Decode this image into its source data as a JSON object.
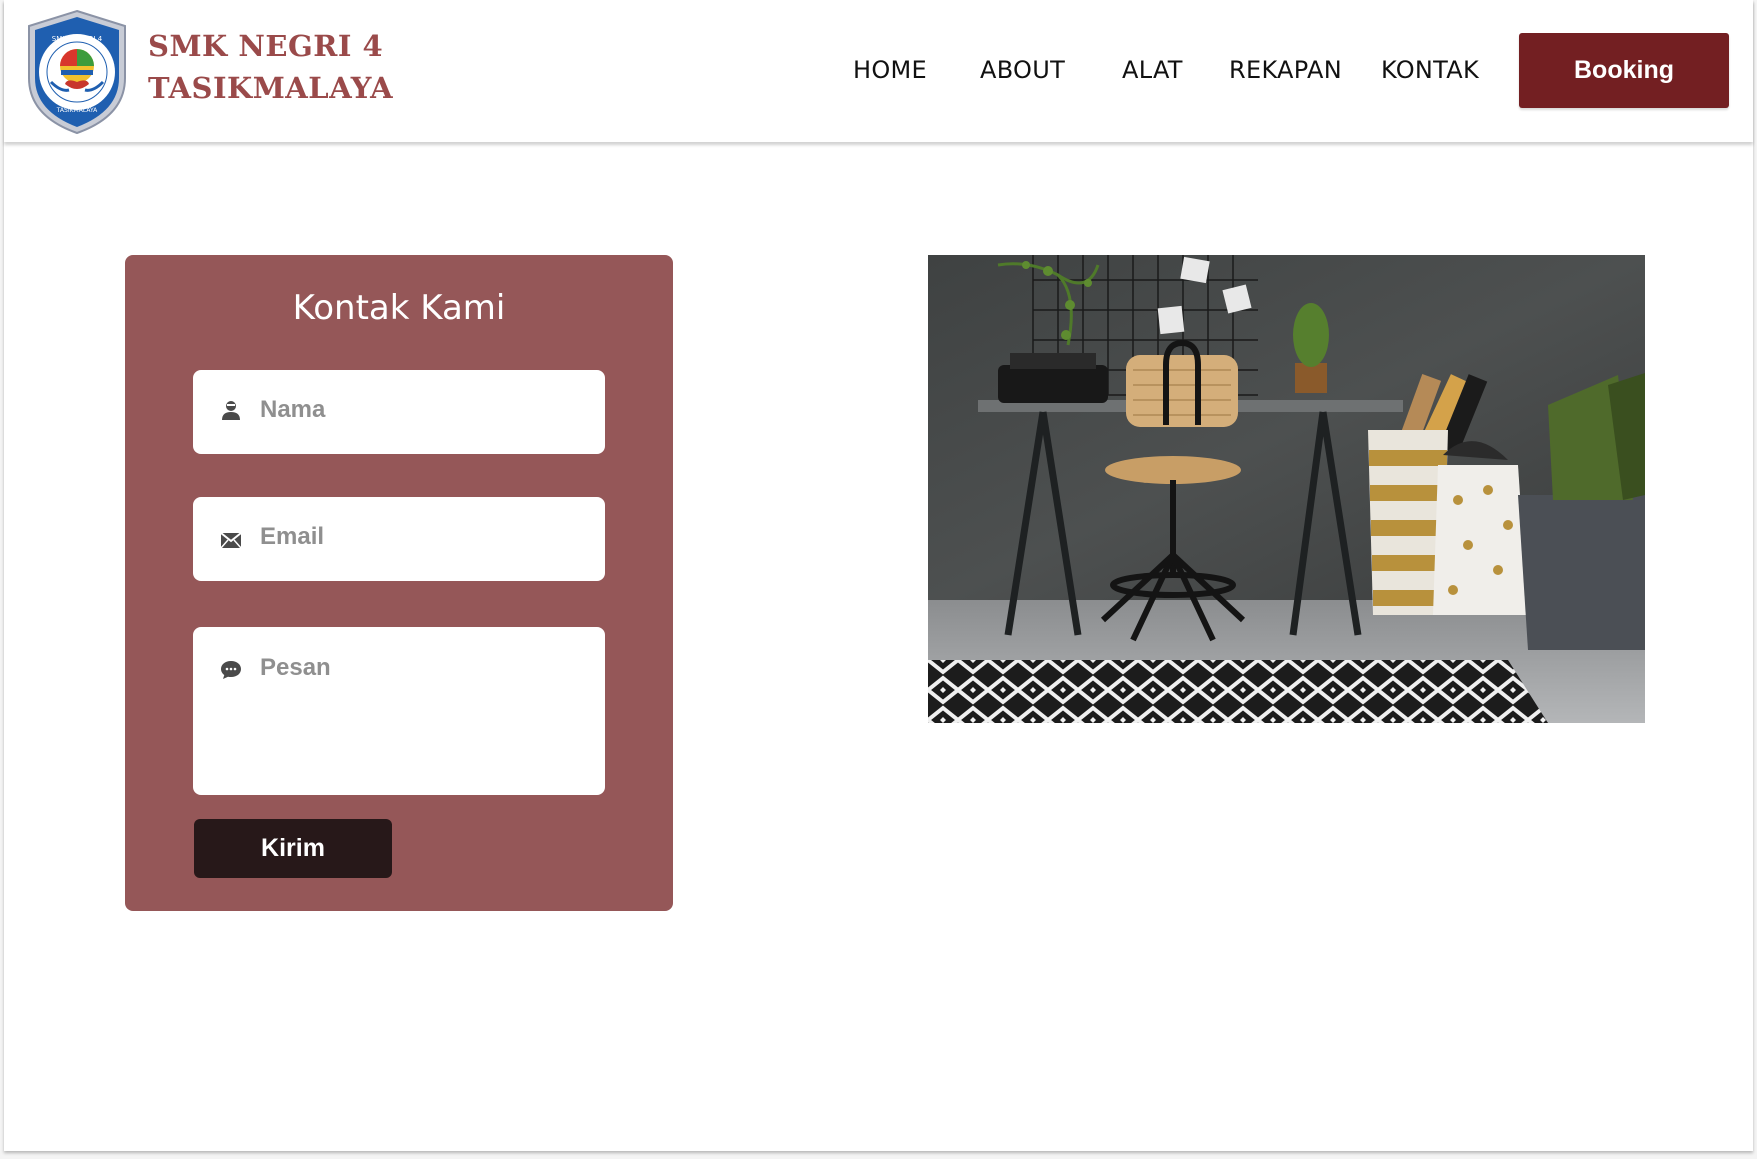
{
  "header": {
    "brand_line1": "SMK NEGRI 4",
    "brand_line2": "TASIKMALAYA",
    "logo_text_top": "SMK NEGERI 4",
    "logo_text_bottom": "TASIKMALAYA",
    "nav": {
      "home": "HOME",
      "about": "ABOUT",
      "alat": "ALAT",
      "rekapan": "REKAPAN",
      "kontak": "KONTAK"
    },
    "booking_label": "Booking"
  },
  "contact_form": {
    "title": "Kontak Kami",
    "name_placeholder": "Nama",
    "email_placeholder": "Email",
    "message_placeholder": "Pesan",
    "submit_label": "Kirim"
  },
  "colors": {
    "brand_text": "#9a4a4a",
    "booking_bg": "#731f22",
    "card_bg": "#955758",
    "submit_bg": "#271819"
  },
  "icons": {
    "name": "user-icon",
    "email": "envelope-icon",
    "message": "chat-bubble-icon"
  }
}
